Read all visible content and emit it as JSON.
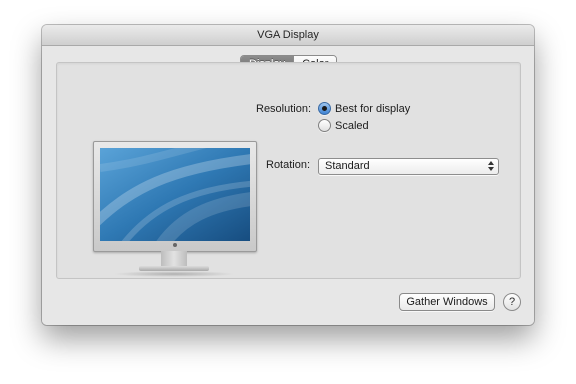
{
  "window": {
    "title": "VGA Display"
  },
  "tabs": [
    {
      "label": "Display",
      "active": true
    },
    {
      "label": "Color",
      "active": false
    }
  ],
  "resolution": {
    "label": "Resolution:",
    "options": [
      {
        "label": "Best for display",
        "selected": true
      },
      {
        "label": "Scaled",
        "selected": false
      }
    ]
  },
  "rotation": {
    "label": "Rotation:",
    "value": "Standard"
  },
  "buttons": {
    "gather": "Gather Windows",
    "help": "?"
  },
  "icons": {
    "monitor": "display-monitor-icon",
    "popup_arrows": "up-down-arrows-icon"
  },
  "colors": {
    "accent": "#3d82d4",
    "screen": "#2a6fa5"
  }
}
